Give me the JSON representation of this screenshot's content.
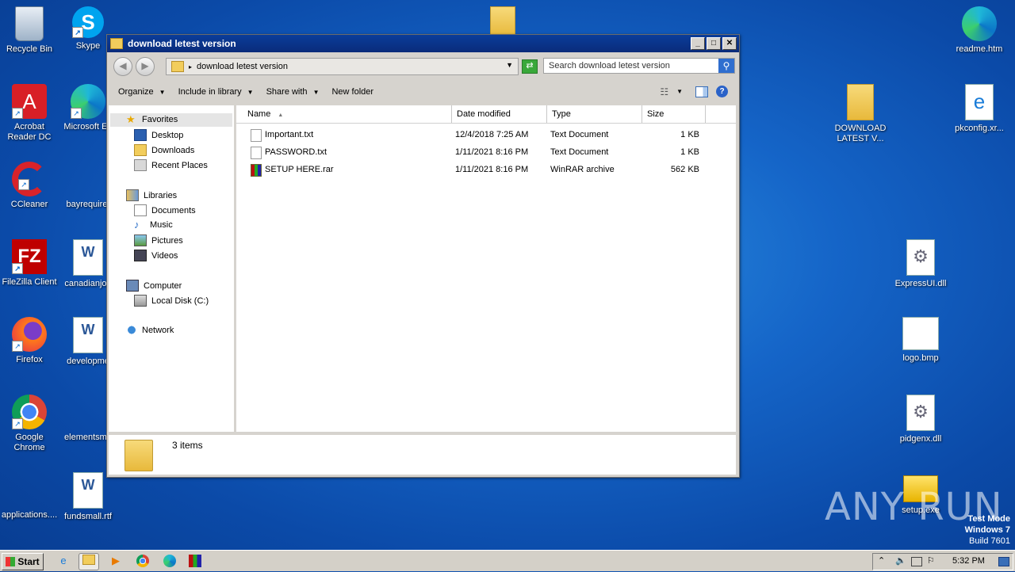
{
  "desktop": {
    "icons": [
      {
        "label": "Recycle Bin",
        "icon": "recycle-bin-icon"
      },
      {
        "label": "Skype",
        "icon": "skype-icon"
      },
      {
        "label": "Acrobat Reader DC",
        "icon": "acrobat-icon"
      },
      {
        "label": "Microsoft Ed",
        "icon": "edge-icon"
      },
      {
        "label": "CCleaner",
        "icon": "ccleaner-icon"
      },
      {
        "label": "bayrequire.",
        "icon": "blank-file-icon"
      },
      {
        "label": "FileZilla Client",
        "icon": "filezilla-icon"
      },
      {
        "label": "canadianjob",
        "icon": "word-doc-icon"
      },
      {
        "label": "Firefox",
        "icon": "firefox-icon"
      },
      {
        "label": "developme",
        "icon": "word-doc-icon"
      },
      {
        "label": "Google Chrome",
        "icon": "chrome-icon"
      },
      {
        "label": "elementsma",
        "icon": "blank-file-icon"
      },
      {
        "label": "applications....",
        "icon": "blank-file-icon"
      },
      {
        "label": "fundsmall.rtf",
        "icon": "word-doc-icon"
      },
      {
        "label": "readme.htm",
        "icon": "edge-icon"
      },
      {
        "label": "DOWNLOAD LATEST V...",
        "icon": "folder-icon"
      },
      {
        "label": "pkconfig.xr...",
        "icon": "ie-file-icon"
      },
      {
        "label": "ExpressUI.dll",
        "icon": "dll-icon"
      },
      {
        "label": "logo.bmp",
        "icon": "bmp-icon"
      },
      {
        "label": "pidgenx.dll",
        "icon": "dll-icon"
      },
      {
        "label": "setup.exe",
        "icon": "office-setup-icon"
      }
    ],
    "watermark": "ANY RUN",
    "test_mode": {
      "line1": "Test Mode",
      "line2": "Windows 7",
      "line3": "Build 7601"
    }
  },
  "window": {
    "title": "download letest version",
    "address": "download letest version",
    "search_placeholder": "Search download letest version",
    "toolbar": {
      "organize": "Organize",
      "include": "Include in library",
      "share": "Share with",
      "new_folder": "New folder"
    },
    "nav": {
      "favorites": "Favorites",
      "desktop": "Desktop",
      "downloads": "Downloads",
      "recent": "Recent Places",
      "libraries": "Libraries",
      "documents": "Documents",
      "music": "Music",
      "pictures": "Pictures",
      "videos": "Videos",
      "computer": "Computer",
      "local_disk": "Local Disk (C:)",
      "network": "Network"
    },
    "columns": {
      "name": "Name",
      "date": "Date modified",
      "type": "Type",
      "size": "Size"
    },
    "files": [
      {
        "name": "Important.txt",
        "date": "12/4/2018 7:25 AM",
        "type": "Text Document",
        "size": "1 KB"
      },
      {
        "name": "PASSWORD.txt",
        "date": "1/11/2021 8:16 PM",
        "type": "Text Document",
        "size": "1 KB"
      },
      {
        "name": "SETUP HERE.rar",
        "date": "1/11/2021 8:16 PM",
        "type": "WinRAR archive",
        "size": "562 KB"
      }
    ],
    "status": "3 items"
  },
  "taskbar": {
    "start": "Start",
    "time": "5:32 PM"
  }
}
